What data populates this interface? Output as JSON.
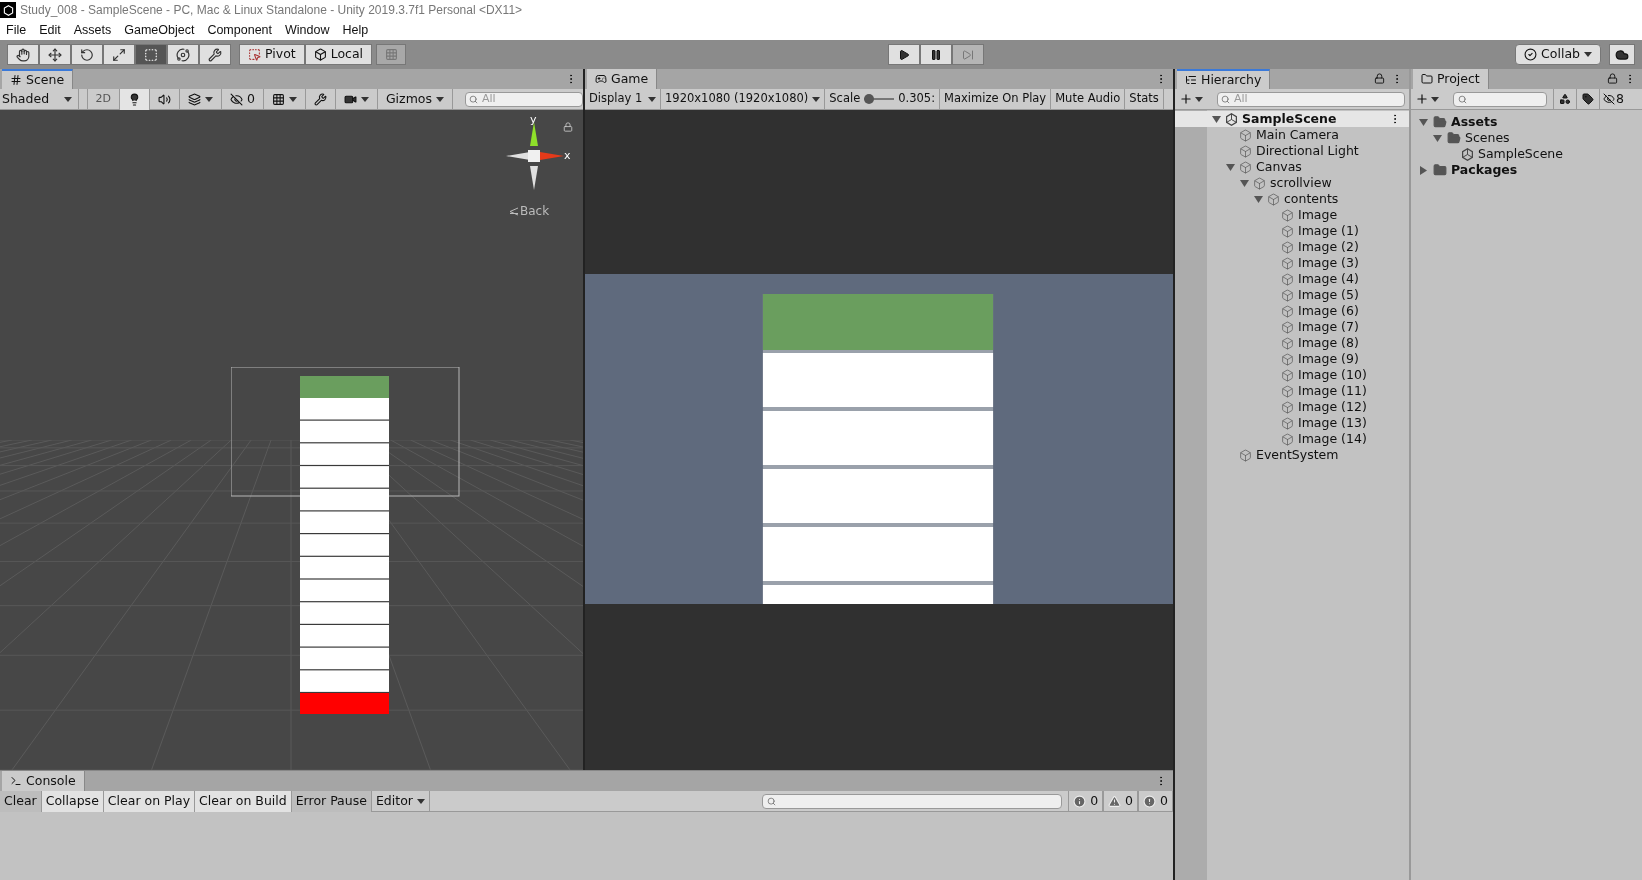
{
  "window": {
    "title": "Study_008 - SampleScene - PC, Mac & Linux Standalone - Unity 2019.3.7f1 Personal <DX11>"
  },
  "menu": [
    "File",
    "Edit",
    "Assets",
    "GameObject",
    "Component",
    "Window",
    "Help"
  ],
  "toolbar": {
    "tools": [
      {
        "kind": "hand",
        "selected": false
      },
      {
        "kind": "move",
        "selected": false
      },
      {
        "kind": "rotate",
        "selected": false
      },
      {
        "kind": "scale",
        "selected": false
      },
      {
        "kind": "rect",
        "selected": true
      },
      {
        "kind": "transform",
        "selected": false
      },
      {
        "kind": "custom",
        "selected": false
      }
    ],
    "pivot": "Pivot",
    "local": "Local",
    "collab": "Collab"
  },
  "scene": {
    "tab": "Scene",
    "shading": "Shaded",
    "mode_2d": {
      "label": "2D",
      "on": false
    },
    "lighting_on": true,
    "hidden_count": "0",
    "gizmos": "Gizmos",
    "search_placeholder": "All",
    "gizmo": {
      "y": "y",
      "x": "x",
      "back": "Back"
    }
  },
  "game": {
    "tab": "Game",
    "display": "Display 1",
    "resolution": "1920x1080 (1920x1080)",
    "scale_label": "Scale",
    "scale": {
      "level": 0
    },
    "scale_value": "0.305:",
    "toggles": [
      {
        "label": "Maximize On Play",
        "on": false
      },
      {
        "label": "Mute Audio",
        "on": false
      },
      {
        "label": "Stats",
        "on": false
      }
    ]
  },
  "hierarchy": {
    "tab": "Hierarchy",
    "search_placeholder": "All",
    "tree": [
      {
        "label": "SampleScene",
        "kind": "scene",
        "selected": true,
        "expanded": true,
        "children": [
          {
            "label": "Main Camera",
            "kind": "object",
            "selected": false
          },
          {
            "label": "Directional Light",
            "kind": "object",
            "selected": false
          },
          {
            "label": "Canvas",
            "kind": "object",
            "selected": false,
            "expanded": true,
            "children": [
              {
                "label": "scrollview",
                "kind": "object",
                "selected": false,
                "expanded": true,
                "children": [
                  {
                    "label": "contents",
                    "kind": "object",
                    "selected": false,
                    "expanded": true,
                    "children": [
                      {
                        "label": "Image",
                        "kind": "object",
                        "selected": false
                      },
                      {
                        "label": "Image (1)",
                        "kind": "object",
                        "selected": false
                      },
                      {
                        "label": "Image (2)",
                        "kind": "object",
                        "selected": false
                      },
                      {
                        "label": "Image (3)",
                        "kind": "object",
                        "selected": false
                      },
                      {
                        "label": "Image (4)",
                        "kind": "object",
                        "selected": false
                      },
                      {
                        "label": "Image (5)",
                        "kind": "object",
                        "selected": false
                      },
                      {
                        "label": "Image (6)",
                        "kind": "object",
                        "selected": false
                      },
                      {
                        "label": "Image (7)",
                        "kind": "object",
                        "selected": false
                      },
                      {
                        "label": "Image (8)",
                        "kind": "object",
                        "selected": false
                      },
                      {
                        "label": "Image (9)",
                        "kind": "object",
                        "selected": false
                      },
                      {
                        "label": "Image (10)",
                        "kind": "object",
                        "selected": false
                      },
                      {
                        "label": "Image (11)",
                        "kind": "object",
                        "selected": false
                      },
                      {
                        "label": "Image (12)",
                        "kind": "object",
                        "selected": false
                      },
                      {
                        "label": "Image (13)",
                        "kind": "object",
                        "selected": false
                      },
                      {
                        "label": "Image (14)",
                        "kind": "object",
                        "selected": false
                      }
                    ]
                  }
                ]
              }
            ]
          },
          {
            "label": "EventSystem",
            "kind": "object",
            "selected": false
          }
        ]
      }
    ]
  },
  "project": {
    "tab": "Project",
    "hidden_count": "8",
    "tree": [
      {
        "label": "Assets",
        "kind": "folder",
        "expanded": true,
        "children": [
          {
            "label": "Scenes",
            "kind": "folder",
            "expanded": true,
            "children": [
              {
                "label": "SampleScene",
                "kind": "scene"
              }
            ]
          }
        ]
      },
      {
        "label": "Packages",
        "kind": "folder",
        "expanded": false
      }
    ]
  },
  "console": {
    "tab": "Console",
    "buttons": [
      {
        "label": "Clear",
        "on": true
      },
      {
        "label": "Collapse",
        "on": false
      },
      {
        "label": "Clear on Play",
        "on": false
      },
      {
        "label": "Clear on Build",
        "on": false
      },
      {
        "label": "Error Pause",
        "on": true
      }
    ],
    "dropdown": "Editor",
    "counts": [
      {
        "kind": "info",
        "value": "0"
      },
      {
        "kind": "warning",
        "value": "0"
      },
      {
        "kind": "error",
        "value": "0"
      }
    ]
  }
}
